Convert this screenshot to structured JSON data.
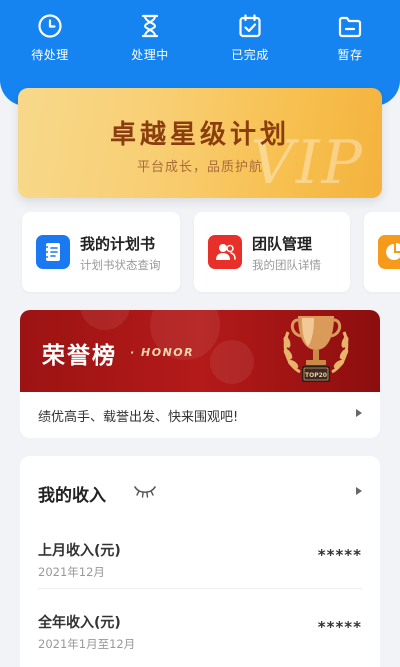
{
  "status_tabs": [
    {
      "label": "待处理",
      "icon": "clock-icon"
    },
    {
      "label": "处理中",
      "icon": "hourglass-icon"
    },
    {
      "label": "已完成",
      "icon": "check-calendar-icon"
    },
    {
      "label": "暂存",
      "icon": "folder-icon"
    }
  ],
  "vip_banner": {
    "title": "卓越星级计划",
    "subtitle": "平台成长，品质护航",
    "watermark": "VIP"
  },
  "shortcuts": [
    {
      "title": "我的计划书",
      "subtitle": "计划书状态查询",
      "icon": "notebook-icon",
      "color": "#1a78f0"
    },
    {
      "title": "团队管理",
      "subtitle": "我的团队详情",
      "icon": "team-icon",
      "color": "#e8302a"
    },
    {
      "title": "",
      "subtitle": "",
      "icon": "pie-chart-icon",
      "color": "#f59a1b"
    }
  ],
  "honor": {
    "title": "荣誉榜",
    "title_en": "· HONOR",
    "trophy_label": "TOP20",
    "message": "绩优高手、载誉出发、快来围观吧!"
  },
  "income": {
    "title": "我的收入",
    "rows": [
      {
        "label": "上月收入(元)",
        "period": "2021年12月",
        "value": "*****"
      },
      {
        "label": "全年收入(元)",
        "period": "2021年1月至12月",
        "value": "*****"
      }
    ]
  },
  "colors": {
    "primary_blue": "#1684f0",
    "honor_red": "#b41a1a",
    "vip_gold": "#f7c55a"
  }
}
